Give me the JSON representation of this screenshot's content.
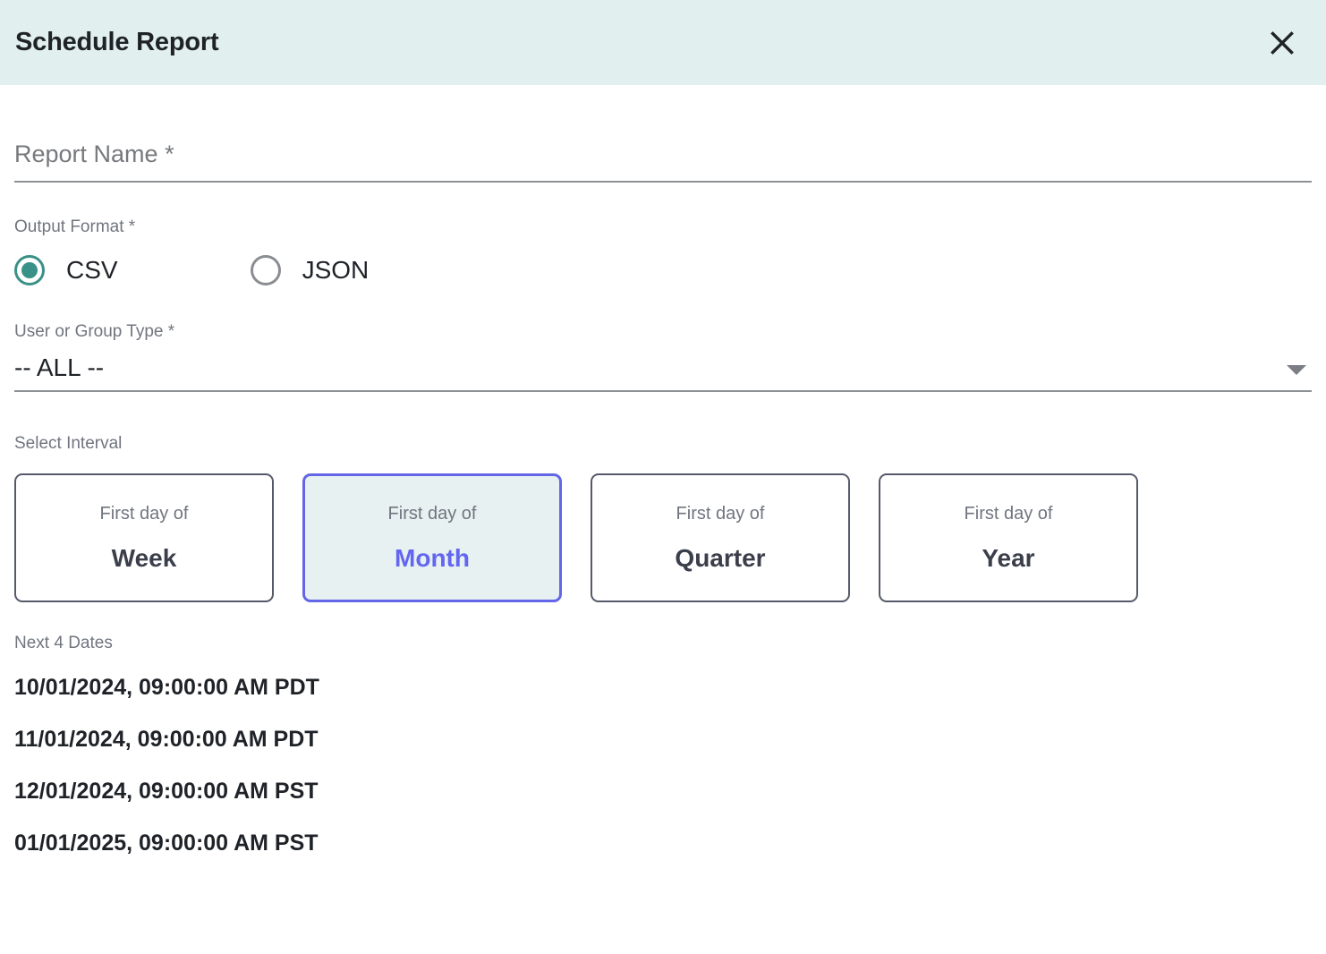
{
  "dialog": {
    "title": "Schedule Report",
    "close_icon": "close-icon"
  },
  "report_name": {
    "label": "Report Name *",
    "placeholder": "Report Name *",
    "value": ""
  },
  "output_format": {
    "label": "Output Format *",
    "selected": "CSV",
    "options": [
      {
        "label": "CSV",
        "checked": true
      },
      {
        "label": "JSON",
        "checked": false
      }
    ]
  },
  "user_group_type": {
    "label": "User or Group Type *",
    "value": "-- ALL --",
    "arrow_icon": "chevron-down-icon"
  },
  "interval": {
    "label": "Select Interval",
    "selected": "Month",
    "cards": [
      {
        "prefix": "First day of",
        "name": "Week",
        "selected": false
      },
      {
        "prefix": "First day of",
        "name": "Month",
        "selected": true
      },
      {
        "prefix": "First day of",
        "name": "Quarter",
        "selected": false
      },
      {
        "prefix": "First day of",
        "name": "Year",
        "selected": false
      }
    ]
  },
  "next_dates": {
    "label": "Next 4 Dates",
    "items": [
      "10/01/2024, 09:00:00 AM PDT",
      "11/01/2024, 09:00:00 AM PDT",
      "12/01/2024, 09:00:00 AM PST",
      "01/01/2025, 09:00:00 AM PST"
    ]
  },
  "colors": {
    "header_background": "#e1efef",
    "radio_accent": "#3a9187",
    "selected_card_border": "#6366e8",
    "selected_card_text": "#6366f1",
    "selected_card_background": "#e7f1f1",
    "card_border": "#555a6b",
    "label_text": "#70757f",
    "body_text": "#1f2328"
  }
}
